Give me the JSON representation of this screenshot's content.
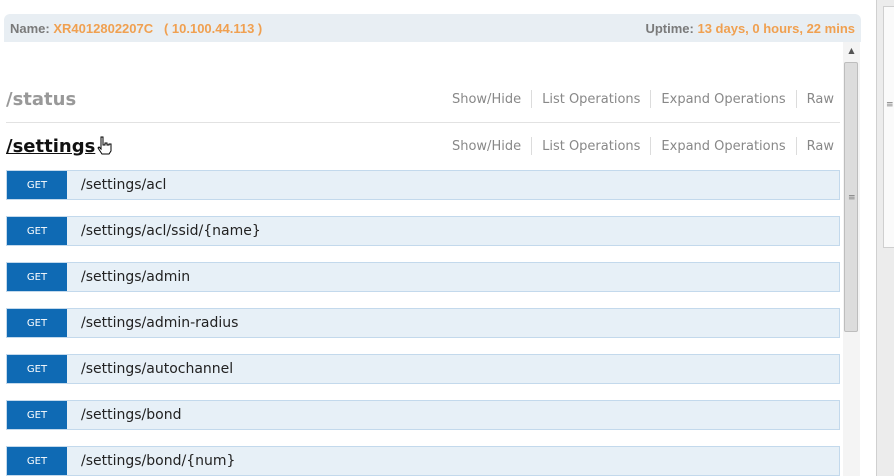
{
  "header": {
    "name_label": "Name:",
    "name_value": "XR4012802207C   ( 10.100.44.113 )",
    "uptime_label": "Uptime:",
    "uptime_value": "13 days, 0 hours, 22 mins"
  },
  "resources": [
    {
      "title": "/status",
      "ops": [
        "Show/Hide",
        "List Operations",
        "Expand Operations",
        "Raw"
      ]
    },
    {
      "title": "/settings",
      "ops": [
        "Show/Hide",
        "List Operations",
        "Expand Operations",
        "Raw"
      ]
    }
  ],
  "operations": [
    {
      "verb": "GET",
      "path": "/settings/acl"
    },
    {
      "verb": "GET",
      "path": "/settings/acl/ssid/{name}"
    },
    {
      "verb": "GET",
      "path": "/settings/admin"
    },
    {
      "verb": "GET",
      "path": "/settings/admin-radius"
    },
    {
      "verb": "GET",
      "path": "/settings/autochannel"
    },
    {
      "verb": "GET",
      "path": "/settings/bond"
    },
    {
      "verb": "GET",
      "path": "/settings/bond/{num}"
    }
  ],
  "icons": {
    "scroll_up": "triangle-up-icon",
    "cursor": "hand-pointer-icon"
  },
  "colors": {
    "header_value": "#f0a050",
    "verb_get": "#0f6ab4",
    "row_bg": "#e7f0f7"
  }
}
